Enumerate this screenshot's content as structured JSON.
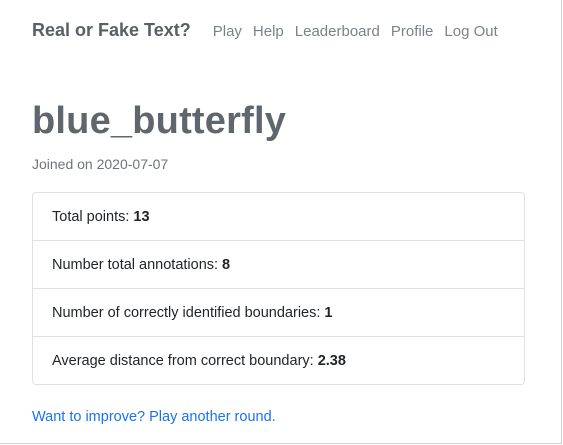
{
  "navbar": {
    "brand": "Real or Fake Text?",
    "links": [
      "Play",
      "Help",
      "Leaderboard",
      "Profile",
      "Log Out"
    ]
  },
  "profile": {
    "username": "blue_butterfly",
    "joined": "Joined on 2020-07-07"
  },
  "stats": [
    {
      "label": "Total points:",
      "value": "13"
    },
    {
      "label": "Number total annotations:",
      "value": "8"
    },
    {
      "label": "Number of correctly identified boundaries:",
      "value": "1"
    },
    {
      "label": "Average distance from correct boundary:",
      "value": "2.38"
    }
  ],
  "improve_link": "Want to improve? Play another round.",
  "colors": {
    "link": "#1a73e8",
    "heading": "#5f666c",
    "nav": "#7b8288",
    "border": "#dee2e6"
  }
}
